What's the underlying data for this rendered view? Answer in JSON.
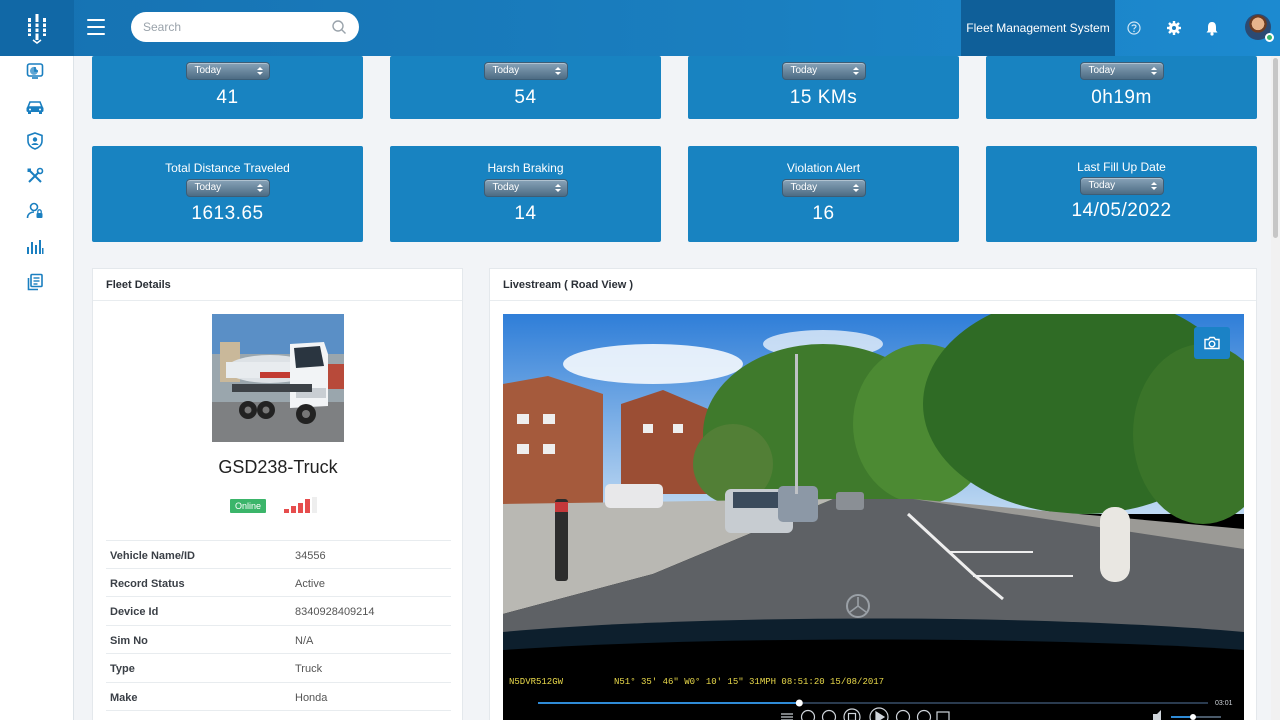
{
  "header": {
    "search_placeholder": "Search",
    "app_title": "Fleet Management System"
  },
  "stats_top": [
    {
      "period": "Today",
      "value": "41"
    },
    {
      "period": "Today",
      "value": "54"
    },
    {
      "period": "Today",
      "value": "15 KMs"
    },
    {
      "period": "Today",
      "value": "0h19m"
    }
  ],
  "stats_bottom": [
    {
      "title": "Total Distance Traveled",
      "period": "Today",
      "value": "1613.65"
    },
    {
      "title": "Harsh Braking",
      "period": "Today",
      "value": "14"
    },
    {
      "title": "Violation Alert",
      "period": "Today",
      "value": "16"
    },
    {
      "title": "Last Fill Up Date",
      "period": "Today",
      "value": "14/05/2022"
    }
  ],
  "fleet": {
    "title": "Fleet Details",
    "vehicle_name": "GSD238-Truck",
    "status": "Online",
    "details": [
      {
        "key": "Vehicle Name/ID",
        "value": "34556"
      },
      {
        "key": "Record Status",
        "value": "Active"
      },
      {
        "key": "Device Id",
        "value": "8340928409214"
      },
      {
        "key": "Sim No",
        "value": "N/A"
      },
      {
        "key": "Type",
        "value": "Truck"
      },
      {
        "key": "Make",
        "value": "Honda"
      }
    ]
  },
  "livestream": {
    "title": "Livestream ( Road View )",
    "osd_plate": "N5DVR512GW",
    "osd_info": "N51° 35' 46\"  W0° 10' 15\"  31MPH  08:51:20  15/08/2017",
    "time": "03:01",
    "progress": 0.39
  },
  "colors": {
    "accent": "#1883c1",
    "header": "#1a7fc0",
    "online": "#3bb56a",
    "signal": "#e64d4d"
  }
}
